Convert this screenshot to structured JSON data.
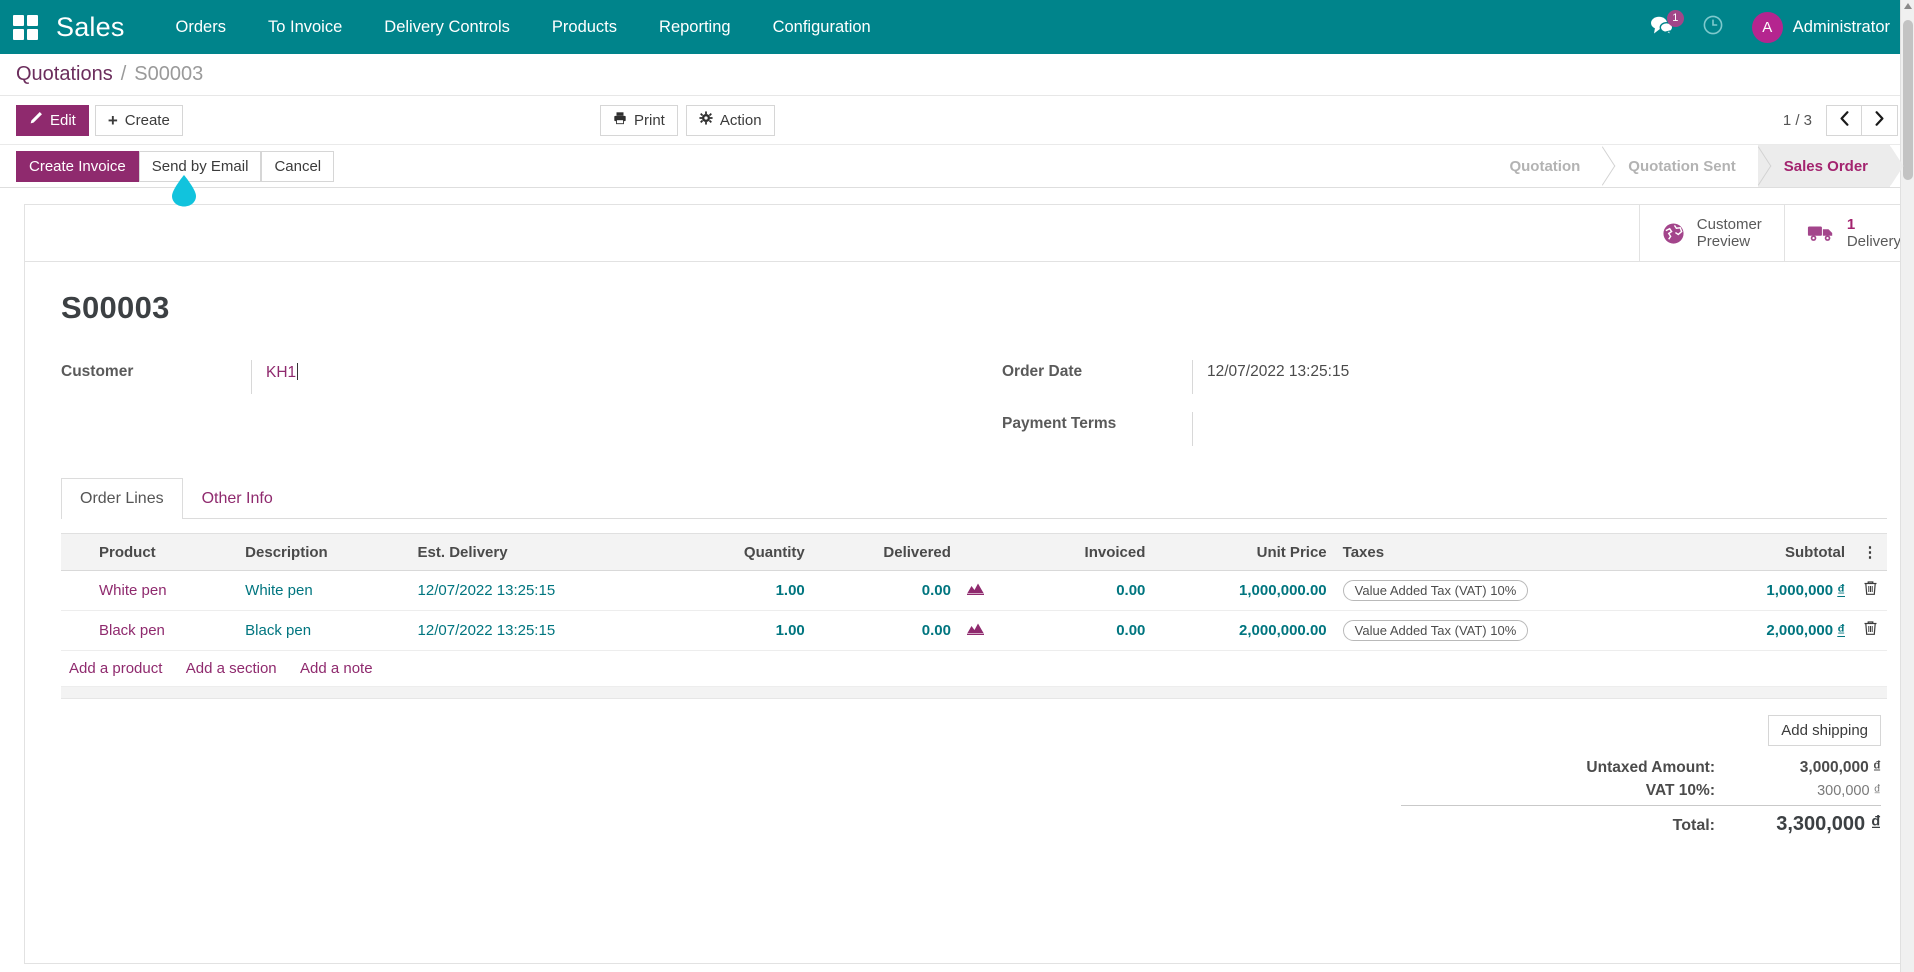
{
  "navbar": {
    "apps_icon": "apps-grid-icon",
    "brand": "Sales",
    "menu": [
      {
        "label": "Orders"
      },
      {
        "label": "To Invoice"
      },
      {
        "label": "Delivery Controls"
      },
      {
        "label": "Products"
      },
      {
        "label": "Reporting"
      },
      {
        "label": "Configuration"
      }
    ],
    "messages_icon": "messages-icon",
    "messages_badge": "1",
    "activities_icon": "clock-icon",
    "avatar_initial": "A",
    "user_name": "Administrator"
  },
  "breadcrumb": {
    "root": "Quotations",
    "separator": "/",
    "current": "S00003"
  },
  "control_panel": {
    "edit_label": "Edit",
    "create_label": "Create",
    "print_label": "Print",
    "action_label": "Action",
    "pager": "1 / 3",
    "prev_icon": "chevron-left-icon",
    "next_icon": "chevron-right-icon"
  },
  "action_bar": {
    "create_invoice_label": "Create Invoice",
    "send_by_email_label": "Send by Email",
    "cancel_label": "Cancel"
  },
  "statusbar": {
    "items": [
      {
        "label": "Quotation",
        "active": false
      },
      {
        "label": "Quotation Sent",
        "active": false
      },
      {
        "label": "Sales Order",
        "active": true
      }
    ]
  },
  "smart_buttons": [
    {
      "icon": "globe-icon",
      "line1": "Customer",
      "line2": "Preview",
      "is_count": false
    },
    {
      "icon": "truck-icon",
      "line1": "1",
      "line2": "Delivery",
      "is_count": true
    }
  ],
  "record": {
    "title": "S00003",
    "fields_left": [
      {
        "label": "Customer",
        "value": "KH1",
        "link": true,
        "cursor": true
      }
    ],
    "fields_right": [
      {
        "label": "Order Date",
        "value": "12/07/2022 13:25:15",
        "link": false
      },
      {
        "label": "Payment Terms",
        "value": "",
        "link": false
      }
    ]
  },
  "notebook": {
    "tabs": [
      {
        "label": "Order Lines",
        "active": true
      },
      {
        "label": "Other Info",
        "active": false
      }
    ]
  },
  "order_lines": {
    "columns": [
      {
        "label": "Product",
        "align": "left"
      },
      {
        "label": "Description",
        "align": "left"
      },
      {
        "label": "Est. Delivery",
        "align": "left"
      },
      {
        "label": "Quantity",
        "align": "right"
      },
      {
        "label": "Delivered",
        "align": "right"
      },
      {
        "label": "",
        "align": "left"
      },
      {
        "label": "Invoiced",
        "align": "right"
      },
      {
        "label": "Unit Price",
        "align": "right"
      },
      {
        "label": "Taxes",
        "align": "left"
      },
      {
        "label": "Subtotal",
        "align": "right"
      },
      {
        "label": "⋮",
        "align": "center"
      }
    ],
    "rows": [
      {
        "product": "White pen",
        "description": "White pen",
        "est_delivery": "12/07/2022 13:25:15",
        "quantity": "1.00",
        "delivered": "0.00",
        "delivered_icon": "area-chart-icon",
        "invoiced": "0.00",
        "unit_price": "1,000,000.00",
        "taxes": "Value Added Tax (VAT) 10%",
        "subtotal": "1,000,000",
        "currency": "₫",
        "delete_icon": "trash-icon"
      },
      {
        "product": "Black pen",
        "description": "Black pen",
        "est_delivery": "12/07/2022 13:25:15",
        "quantity": "1.00",
        "delivered": "0.00",
        "delivered_icon": "area-chart-icon",
        "invoiced": "0.00",
        "unit_price": "2,000,000.00",
        "taxes": "Value Added Tax (VAT) 10%",
        "subtotal": "2,000,000",
        "currency": "₫",
        "delete_icon": "trash-icon"
      }
    ],
    "add_links": [
      {
        "label": "Add a product"
      },
      {
        "label": "Add a section"
      },
      {
        "label": "Add a note"
      }
    ]
  },
  "totals": {
    "add_shipping_label": "Add shipping",
    "untaxed_label": "Untaxed Amount:",
    "untaxed_value": "3,000,000 ₫",
    "vat_label": "VAT 10%:",
    "vat_value": "300,000 ₫",
    "total_label": "Total:",
    "total_value": "3,300,000 ₫"
  },
  "cursor": {
    "type": "droplet-pointer",
    "color": "#11c3dd"
  },
  "colors": {
    "navbar_teal": "#00848b",
    "accent_purple": "#8f2a6e",
    "link_teal": "#00757f",
    "status_active": "#a3246f",
    "avatar_pink": "#b5258f"
  }
}
